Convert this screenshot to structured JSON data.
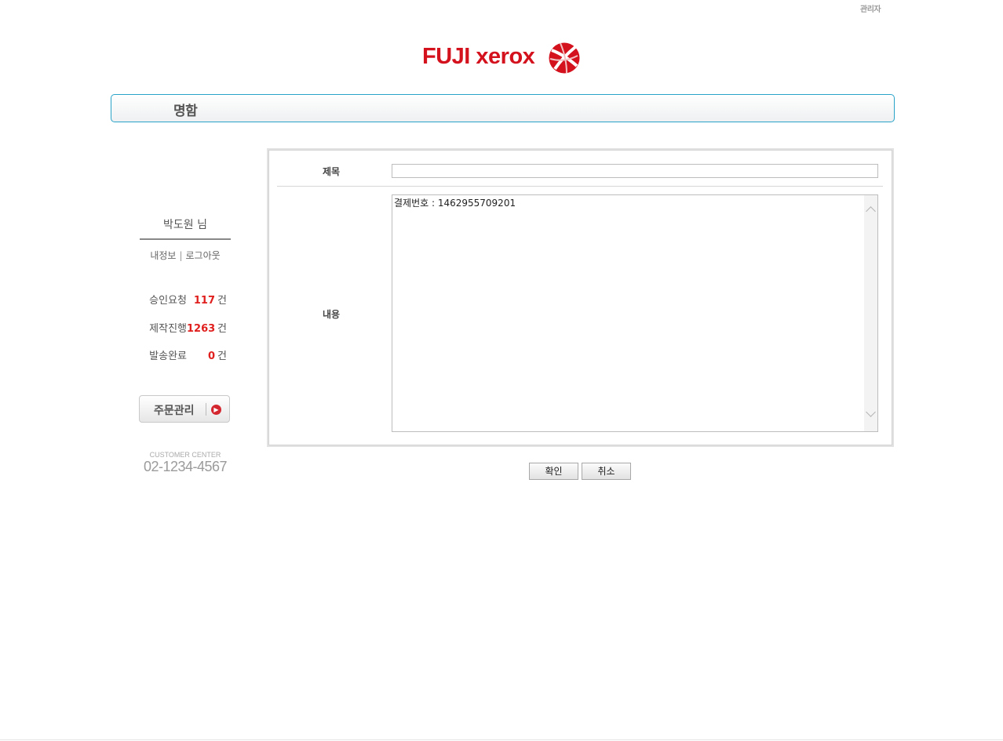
{
  "header": {
    "admin_link": "관리자",
    "logo_text": "FUJI xerox",
    "page_title": "명함"
  },
  "sidebar": {
    "user_name": "박도원 님",
    "my_info_link": "내정보",
    "link_separator": "|",
    "logout_link": "로그아웃",
    "stats": [
      {
        "label": "승인요청",
        "count": "117",
        "unit": "건"
      },
      {
        "label": "제작진행",
        "count": "1263",
        "unit": "건"
      },
      {
        "label": "발송완료",
        "count": "0",
        "unit": "건"
      }
    ],
    "order_button": "주문관리",
    "customer_center_label": "CUSTOMER CENTER",
    "customer_center_phone": "02-1234-4567"
  },
  "form": {
    "subject_label": "제목",
    "subject_value": "",
    "content_label": "내용",
    "content_value": "결제번호 : 1462955709201"
  },
  "buttons": {
    "confirm": "확인",
    "cancel": "취소"
  },
  "colors": {
    "brand_red": "#d4121e",
    "accent_blue": "#2aa3c9",
    "count_red": "#e0201e"
  },
  "icons": {
    "logo": "xerox-globe-icon",
    "order_arrow": "arrow-right-circle-icon",
    "scroll_up": "chevron-up-icon",
    "scroll_down": "chevron-down-icon"
  }
}
